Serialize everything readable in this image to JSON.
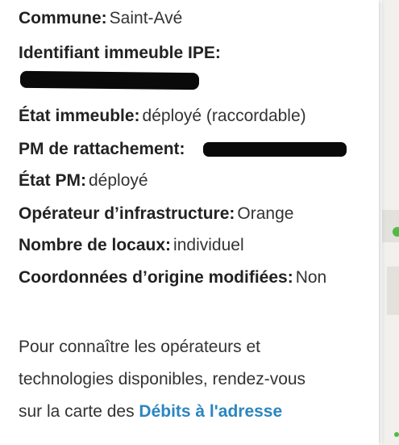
{
  "popup": {
    "fields": [
      {
        "label": "Commune:",
        "value": "Saint-Avé"
      },
      {
        "label": "Identifiant immeuble IPE:",
        "value": ""
      },
      {
        "label": "État immeuble:",
        "value": "déployé (raccordable)"
      },
      {
        "label": "PM de rattachement:",
        "value": ""
      },
      {
        "label": "État PM:",
        "value": "déployé"
      },
      {
        "label": "Opérateur d’infrastructure:",
        "value": "Orange"
      },
      {
        "label": "Nombre de locaux:",
        "value": "individuel"
      },
      {
        "label": "Coordonnées d’origine modifiées:",
        "value": "Non"
      }
    ],
    "promo": {
      "line1": "Pour connaître les opérateurs et",
      "line2": "technologies disponibles, rendez-vous",
      "line3_prefix": "sur la carte des ",
      "link_text": "Débits à l'adresse"
    }
  },
  "colors": {
    "link": "#2b86c0",
    "map_marker": "#54b948",
    "redaction": "#0a0a0a"
  }
}
